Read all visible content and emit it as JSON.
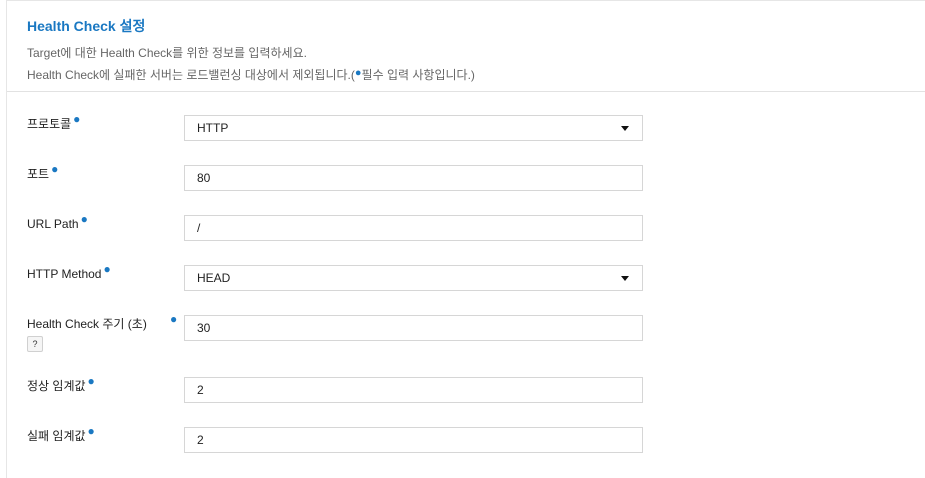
{
  "header": {
    "title": "Health Check 설정",
    "desc_line1": "Target에 대한 Health Check를 위한 정보를 입력하세요.",
    "desc_line2_a": "Health Check에 실패한 서버는 로드밸런싱 대상에서 제외됩니다.(",
    "required_dot": "●",
    "desc_line2_b": "필수 입력 사항입니다.)"
  },
  "form": {
    "protocol": {
      "label": "프로토콜",
      "value": "HTTP"
    },
    "port": {
      "label": "포트",
      "value": "80"
    },
    "url_path": {
      "label": "URL Path",
      "value": "/"
    },
    "http_method": {
      "label": "HTTP Method",
      "value": "HEAD"
    },
    "interval": {
      "label": "Health Check 주기 (초)",
      "value": "30",
      "help_icon": "question-circle-icon"
    },
    "healthy_threshold": {
      "label": "정상 임계값",
      "value": "2"
    },
    "unhealthy_threshold": {
      "label": "실패 임계값",
      "value": "2"
    }
  },
  "colors": {
    "accent": "#1a78c2",
    "border": "#d6d6d6"
  }
}
